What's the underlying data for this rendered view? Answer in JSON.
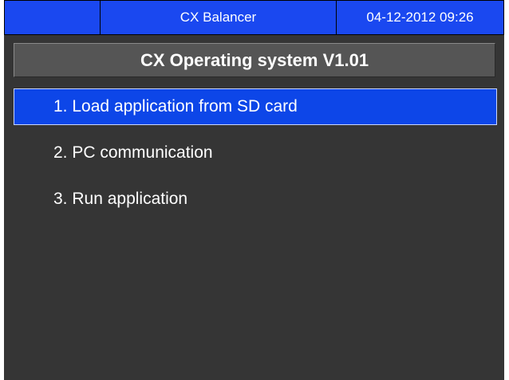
{
  "window": {
    "title": "CX Balancer",
    "datetime": "04-12-2012  09:26"
  },
  "header": {
    "title": "CX Operating system V1.01"
  },
  "menu": {
    "selected_index": 0,
    "items": [
      {
        "label": "1. Load application from SD card"
      },
      {
        "label": "2. PC communication"
      },
      {
        "label": "3. Run application"
      }
    ]
  },
  "colors": {
    "screen_background": "#353535",
    "titlebar": "#1a48f0",
    "selection": "#0d46e8",
    "header_panel": "#555555",
    "text": "#ffffff"
  }
}
